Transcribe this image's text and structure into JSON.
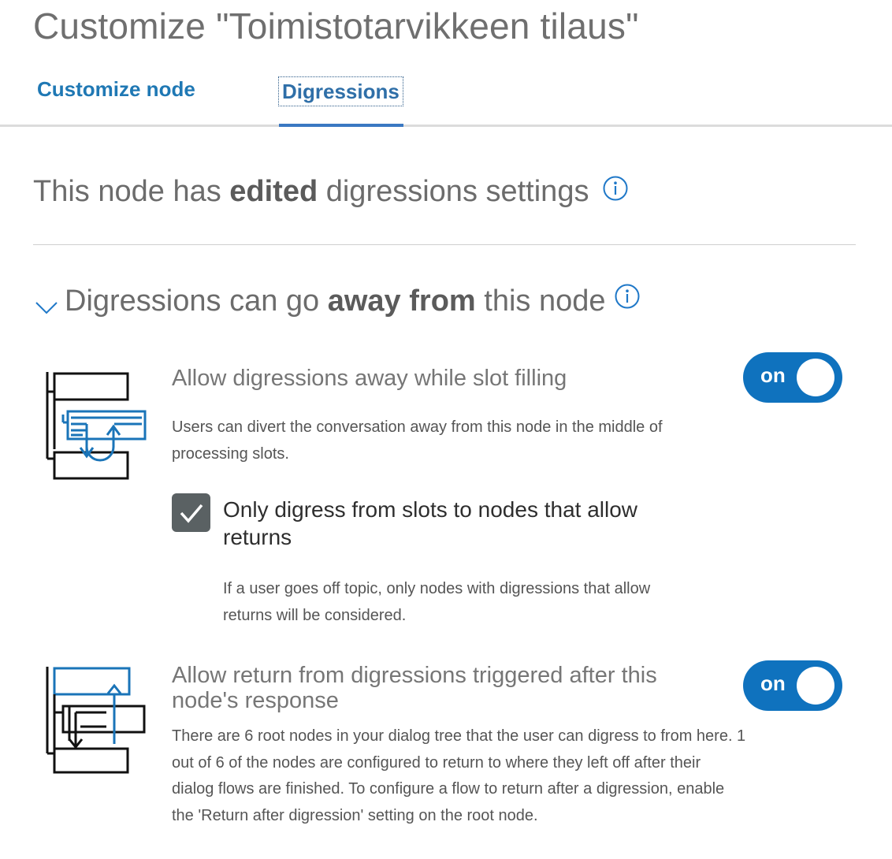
{
  "header": {
    "title": "Customize \"Toimistotarvikkeen tilaus\""
  },
  "tabs": [
    {
      "label": "Customize node",
      "active": false
    },
    {
      "label": "Digressions",
      "active": true
    }
  ],
  "status": {
    "prefix": "This node has ",
    "emphasis": "edited",
    "suffix": " digressions settings"
  },
  "section": {
    "prefix": "Digressions can go ",
    "emphasis": "away from",
    "suffix": " this node",
    "expanded": true
  },
  "settings": {
    "slot_filling": {
      "title": "Allow digressions away while slot filling",
      "description": "Users can divert the conversation away from this node in the middle of processing slots.",
      "toggle_label": "on",
      "enabled": true
    },
    "only_returns": {
      "label": "Only digress from slots to nodes that allow returns",
      "description": "If a user goes off topic, only nodes with digressions that allow returns will be considered.",
      "checked": true
    },
    "allow_return": {
      "title": "Allow return from digressions triggered after this node's response",
      "description": "There are 6 root nodes in your dialog tree that the user can digress to from here. 1 out of 6 of the nodes are configured to return to where they left off after their dialog flows are finished. To configure a flow to return after a digression, enable the 'Return after digression' setting on the root node.",
      "toggle_label": "on",
      "enabled": true
    }
  },
  "colors": {
    "accent": "#0f72be",
    "tab_text": "#1f78b4",
    "checkbox": "#5a6163",
    "illustration_blue": "#1a74b8"
  },
  "icons": {
    "info": "info-circle-icon",
    "chevron": "chevron-down-icon",
    "check": "checkmark-icon"
  }
}
